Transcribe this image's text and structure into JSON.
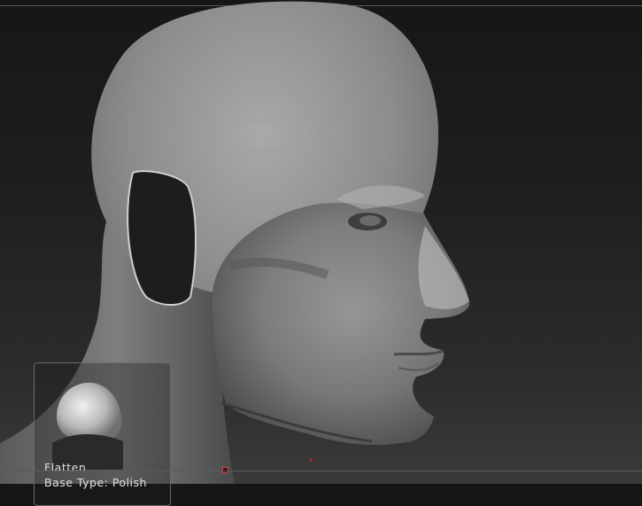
{
  "brush": {
    "name": "Flatten",
    "base_type": "Base Type: Polish"
  },
  "colors": {
    "background_top": "#161616",
    "background_bottom": "#3a3a3a",
    "model": "#8a8a8a",
    "panel_border": "#6a6a6a",
    "marker": "#dd4444"
  },
  "icons": {
    "brush_preview": "flatten-brush-icon"
  }
}
